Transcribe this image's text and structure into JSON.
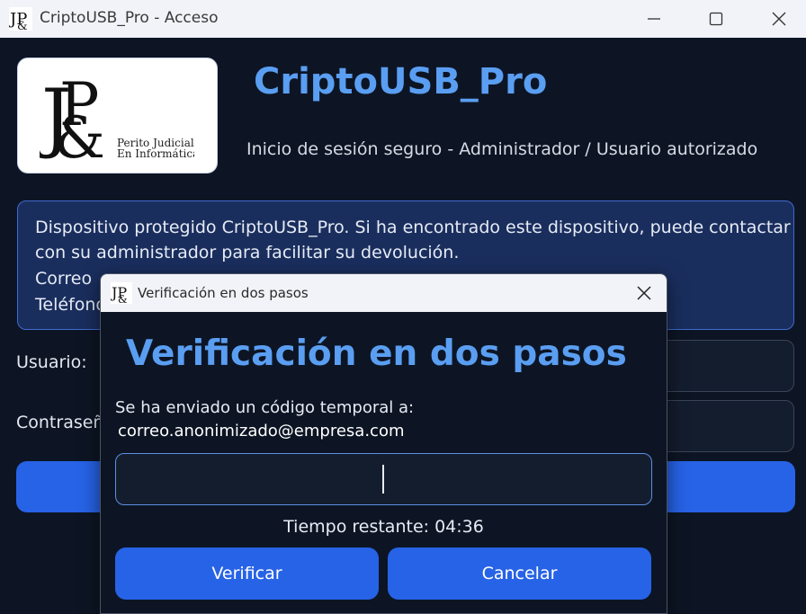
{
  "window": {
    "title": "CriptoUSB_Pro - Acceso"
  },
  "header": {
    "app_title": "CriptoUSB_Pro",
    "subtitle": "Inicio de sesión seguro - Administrador / Usuario autorizado",
    "logo": {
      "line1": "Perito Judicial",
      "line2": "En Informática"
    }
  },
  "notice": {
    "lines": [
      "Dispositivo protegido CriptoUSB_Pro. Si ha encontrado este dispositivo, puede contactar",
      "con su administrador para facilitar su devolución.",
      "Correo",
      "Teléfono"
    ]
  },
  "login_form": {
    "user_label": "Usuario:",
    "password_label": "Contraseñ"
  },
  "dialog": {
    "title": "Verificación en dos pasos",
    "heading": "Verificación en dos pasos",
    "info": "Se ha enviado un código temporal a:",
    "email": "correo.anonimizado@empresa.com",
    "code_value": "",
    "timer_label": "Tiempo restante: 04:36",
    "verify_label": "Verificar",
    "cancel_label": "Cancelar"
  },
  "colors": {
    "background": "#0d1524",
    "accent": "#2763e6",
    "title_blue": "#5a9ef2",
    "notice_bg": "#1a2e5e",
    "notice_border": "#3f6ad0"
  },
  "icons": {
    "app": "jp-logo-icon",
    "minimize": "minimize-icon",
    "maximize": "maximize-icon",
    "close": "close-icon"
  }
}
